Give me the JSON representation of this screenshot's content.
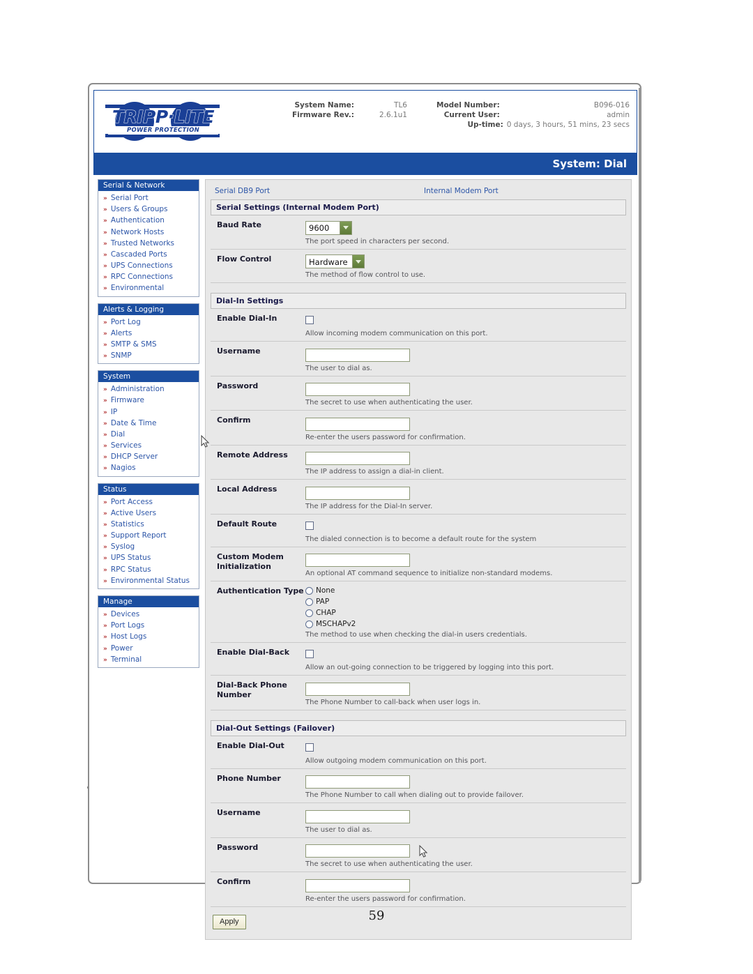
{
  "page": {
    "number": "59"
  },
  "header": {
    "logo": {
      "wordmark": "TRIPP·LITE",
      "tagline": "POWER PROTECTION"
    },
    "info": {
      "system_name_label": "System Name:",
      "system_name_value": "TL6",
      "model_number_label": "Model Number:",
      "model_number_value": "B096-016",
      "firmware_label": "Firmware Rev.:",
      "firmware_value": "2.6.1u1",
      "current_user_label": "Current User:",
      "current_user_value": "admin",
      "uptime_label": "Up-time:",
      "uptime_value": "0 days, 3 hours, 51 mins, 23 secs"
    }
  },
  "titlebar": {
    "title": "System: Dial"
  },
  "sidebar": {
    "groups": [
      {
        "title": "Serial & Network",
        "items": [
          {
            "label": "Serial Port"
          },
          {
            "label": "Users & Groups"
          },
          {
            "label": "Authentication"
          },
          {
            "label": "Network Hosts"
          },
          {
            "label": "Trusted Networks"
          },
          {
            "label": "Cascaded Ports"
          },
          {
            "label": "UPS Connections"
          },
          {
            "label": "RPC Connections"
          },
          {
            "label": "Environmental"
          }
        ]
      },
      {
        "title": "Alerts & Logging",
        "items": [
          {
            "label": "Port Log"
          },
          {
            "label": "Alerts"
          },
          {
            "label": "SMTP & SMS"
          },
          {
            "label": "SNMP"
          }
        ]
      },
      {
        "title": "System",
        "items": [
          {
            "label": "Administration"
          },
          {
            "label": "Firmware"
          },
          {
            "label": "IP"
          },
          {
            "label": "Date & Time"
          },
          {
            "label": "Dial"
          },
          {
            "label": "Services"
          },
          {
            "label": "DHCP Server"
          },
          {
            "label": "Nagios"
          }
        ]
      },
      {
        "title": "Status",
        "items": [
          {
            "label": "Port Access"
          },
          {
            "label": "Active Users"
          },
          {
            "label": "Statistics"
          },
          {
            "label": "Support Report"
          },
          {
            "label": "Syslog"
          },
          {
            "label": "UPS Status"
          },
          {
            "label": "RPC Status"
          },
          {
            "label": "Environmental Status"
          }
        ]
      },
      {
        "title": "Manage",
        "items": [
          {
            "label": "Devices"
          },
          {
            "label": "Port Logs"
          },
          {
            "label": "Host Logs"
          },
          {
            "label": "Power"
          },
          {
            "label": "Terminal"
          }
        ]
      }
    ]
  },
  "main": {
    "tabs": [
      {
        "label": "Serial DB9 Port"
      },
      {
        "label": "Internal Modem Port"
      }
    ],
    "serial_settings": {
      "heading": "Serial Settings (Internal Modem Port)",
      "baud_rate": {
        "label": "Baud Rate",
        "value": "9600",
        "hint": "The port speed in characters per second."
      },
      "flow_control": {
        "label": "Flow Control",
        "value": "Hardware",
        "hint": "The method of flow control to use."
      }
    },
    "dial_in": {
      "heading": "Dial-In Settings",
      "enable": {
        "label": "Enable Dial-In",
        "checked": false,
        "hint": "Allow incoming modem communication on this port."
      },
      "username": {
        "label": "Username",
        "value": "",
        "hint": "The user to dial as."
      },
      "password": {
        "label": "Password",
        "value": "",
        "hint": "The secret to use when authenticating the user."
      },
      "confirm": {
        "label": "Confirm",
        "value": "",
        "hint": "Re-enter the users password for confirmation."
      },
      "remote_address": {
        "label": "Remote Address",
        "value": "",
        "hint": "The IP address to assign a dial-in client."
      },
      "local_address": {
        "label": "Local Address",
        "value": "",
        "hint": "The IP address for the Dial-In server."
      },
      "default_route": {
        "label": "Default Route",
        "checked": false,
        "hint": "The dialed connection is to become a default route for the system"
      },
      "custom_modem_init": {
        "label": "Custom Modem Initialization",
        "value": "",
        "hint": "An optional AT command sequence to initialize non-standard modems."
      },
      "auth_type": {
        "label": "Authentication Type",
        "options": [
          {
            "label": "None",
            "selected": false
          },
          {
            "label": "PAP",
            "selected": false
          },
          {
            "label": "CHAP",
            "selected": false
          },
          {
            "label": "MSCHAPv2",
            "selected": false
          }
        ],
        "hint": "The method to use when checking the dial-in users credentials."
      },
      "enable_dial_back": {
        "label": "Enable Dial-Back",
        "checked": false,
        "hint": "Allow an out-going connection to be triggered by logging into this port."
      },
      "dial_back_phone": {
        "label": "Dial-Back Phone Number",
        "value": "",
        "hint": "The Phone Number to call-back when user logs in."
      }
    },
    "dial_out": {
      "heading": "Dial-Out Settings (Failover)",
      "enable": {
        "label": "Enable Dial-Out",
        "checked": false,
        "hint": "Allow outgoing modem communication on this port."
      },
      "phone_number": {
        "label": "Phone Number",
        "value": "",
        "hint": "The Phone Number to call when dialing out to provide failover."
      },
      "username": {
        "label": "Username",
        "value": "",
        "hint": "The user to dial as."
      },
      "password": {
        "label": "Password",
        "value": "",
        "hint": "The secret to use when authenticating the user."
      },
      "confirm": {
        "label": "Confirm",
        "value": "",
        "hint": "Re-enter the users password for confirmation."
      }
    },
    "apply_label": "Apply"
  },
  "colors": {
    "brand_blue": "#1b4ea0",
    "link_blue": "#2d56a8",
    "chevron_red": "#b03030",
    "panel_gray": "#e8e8e8",
    "field_border": "#8f9a78"
  }
}
